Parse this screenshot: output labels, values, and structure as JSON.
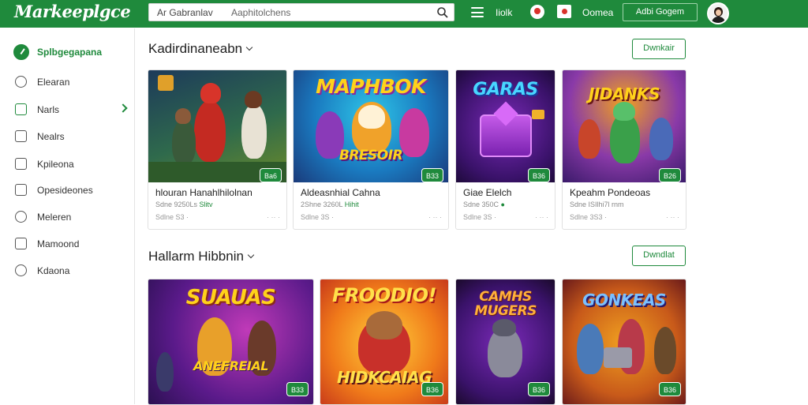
{
  "header": {
    "logo": "Markeeplgce",
    "search_scope": "Ar Gabranlav",
    "search_placeholder": "Aaphitolchens",
    "nav_label": "Iiolk",
    "nav_label2": "Oomea",
    "top_button": "Adbi Gogem",
    "icons": [
      "search-icon",
      "menu-icon",
      "notification-icon",
      "cart-icon"
    ],
    "colors": {
      "brand": "#1f8a3c",
      "accent_red": "#d9332b"
    }
  },
  "sidebar": {
    "items": [
      {
        "label": "Splbgegapana",
        "icon": "store-icon",
        "active": true
      },
      {
        "label": "Elearan",
        "icon": "clock-icon"
      },
      {
        "label": "Narls",
        "icon": "chart-icon",
        "has_chevron": true
      },
      {
        "label": "Nealrs",
        "icon": "tag-icon"
      },
      {
        "label": "Kpileona",
        "icon": "document-icon"
      },
      {
        "label": "Opesideones",
        "icon": "briefcase-icon"
      },
      {
        "label": "Meleren",
        "icon": "location-icon"
      },
      {
        "label": "Mamoond",
        "icon": "file-icon"
      },
      {
        "label": "Kdaona",
        "icon": "gear-icon"
      }
    ]
  },
  "sections": [
    {
      "title": "Kadirdinaneabn",
      "button": "Dwnkair",
      "cards": [
        {
          "art_title": "",
          "badge": "Ba6",
          "name": "hlouran Hanahlhilolnan",
          "meta_a": "Sdne 9250Ls ",
          "meta_green": "Slitv",
          "meta2": "Sdlne S3 ·",
          "more": "· ·· ·"
        },
        {
          "art_title": "MAPHBOK",
          "art_sub": "BRESOIR",
          "badge": "B33",
          "name": "Aldeasnhial Cahna",
          "meta_a": "2Shne 3260L ",
          "meta_green": "Hihit",
          "meta2": "Sdlne 3S ·",
          "more": "· ·· ·"
        },
        {
          "art_title": "GARAS",
          "badge": "B36",
          "name": "Giae Elelch",
          "meta_a": "Sdne 350C ",
          "meta_green": "●",
          "meta2": "Sdlne 3S ·",
          "more": "· ·· ·"
        },
        {
          "art_title": "JIDANKS",
          "badge": "B26",
          "name": "Kpeahm Pondeoas",
          "meta_a": "Sdne ISIlhi7l rnm",
          "meta_green": "",
          "meta2": "Sdlne 3S3 ·",
          "more": "· ·· ·"
        }
      ]
    },
    {
      "title": "Hallarm Hibbnin",
      "button": "Dwndlat",
      "cards": [
        {
          "art_title": "SUAUAS",
          "art_sub": "ANEFREIAL",
          "badge": "B33",
          "name": "",
          "meta_a": "",
          "meta_green": "",
          "meta2": "",
          "more": ""
        },
        {
          "art_title": "FROODIO!",
          "art_sub": "HIDKCAIAG",
          "badge": "B36",
          "name": "",
          "meta_a": "",
          "meta_green": "",
          "meta2": "",
          "more": ""
        },
        {
          "art_title": "CAMHS",
          "art_sub": "MUGERS",
          "badge": "B36",
          "name": "",
          "meta_a": "",
          "meta_green": "",
          "meta2": "",
          "more": ""
        },
        {
          "art_title": "GONKEAS",
          "badge": "B36",
          "name": "",
          "meta_a": "",
          "meta_green": "",
          "meta2": "",
          "more": ""
        }
      ]
    }
  ]
}
